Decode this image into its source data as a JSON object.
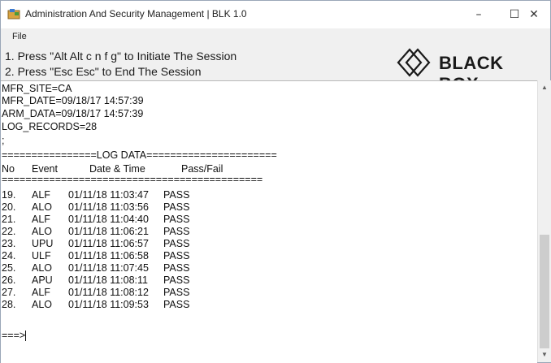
{
  "window": {
    "title": "Administration And Security Management | BLK 1.0",
    "controls": {
      "minimize": "–",
      "maximize": "☐",
      "close": "✕"
    }
  },
  "menu": {
    "file": "File"
  },
  "instructions": {
    "line1": "1. Press \"Alt Alt c n f g\" to Initiate The Session",
    "line2": "2. Press \"Esc Esc\" to End The Session"
  },
  "logo": {
    "text": "BLACK BOX"
  },
  "console": {
    "header_lines": [
      "MFR_SITE=CA",
      "MFR_DATE=09/18/17 14:57:39",
      "ARM_DATA=09/18/17 14:57:39",
      "LOG_RECORDS=28",
      ";"
    ],
    "log_banner": "================LOG DATA======================",
    "columns": {
      "no": "No",
      "event": "Event",
      "datetime": "Date & Time",
      "passfail": "Pass/Fail"
    },
    "separator": "============================================",
    "rows": [
      {
        "no": "19.",
        "event": "ALF",
        "datetime": "01/11/18 11:03:47",
        "result": "PASS"
      },
      {
        "no": "20.",
        "event": "ALO",
        "datetime": "01/11/18 11:03:56",
        "result": "PASS"
      },
      {
        "no": "21.",
        "event": "ALF",
        "datetime": "01/11/18 11:04:40",
        "result": "PASS"
      },
      {
        "no": "22.",
        "event": "ALO",
        "datetime": "01/11/18 11:06:21",
        "result": "PASS"
      },
      {
        "no": "23.",
        "event": "UPU",
        "datetime": "01/11/18 11:06:57",
        "result": "PASS"
      },
      {
        "no": "24.",
        "event": "ULF",
        "datetime": "01/11/18 11:06:58",
        "result": "PASS"
      },
      {
        "no": "25.",
        "event": "ALO",
        "datetime": "01/11/18 11:07:45",
        "result": "PASS"
      },
      {
        "no": "26.",
        "event": "APU",
        "datetime": "01/11/18 11:08:11",
        "result": "PASS"
      },
      {
        "no": "27.",
        "event": "ALF",
        "datetime": "01/11/18 11:08:12",
        "result": "PASS"
      },
      {
        "no": "28.",
        "event": "ALO",
        "datetime": "01/11/18 11:09:53",
        "result": "PASS"
      }
    ],
    "prompt": "===>"
  }
}
